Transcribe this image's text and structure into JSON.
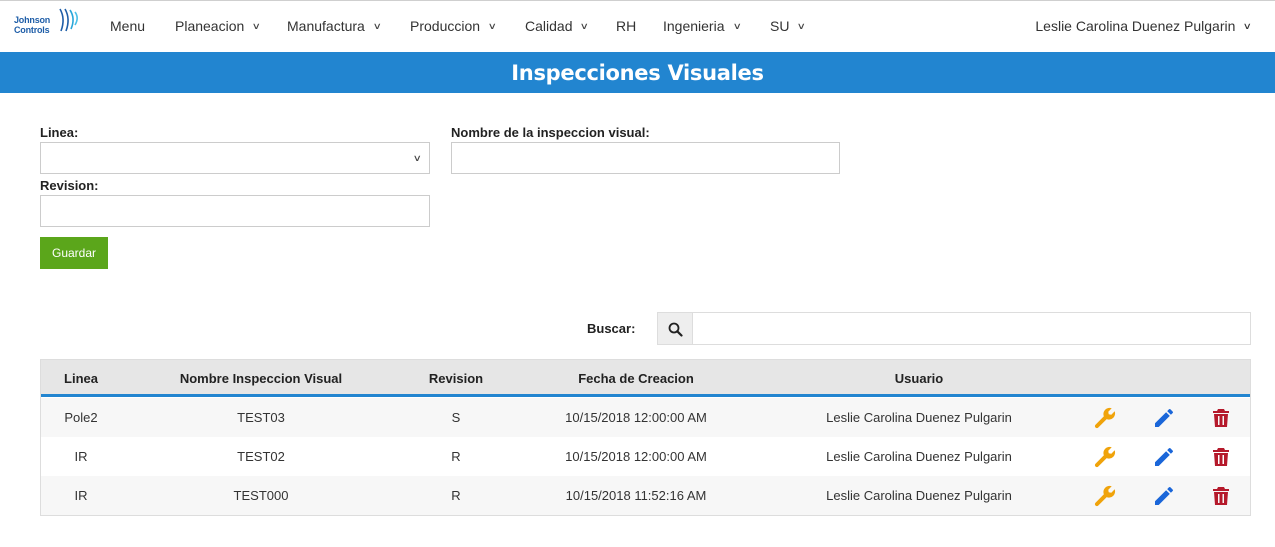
{
  "brand": {
    "line1": "Johnson",
    "line2": "Controls"
  },
  "nav": {
    "items": [
      {
        "label": "Menu",
        "dropdown": false
      },
      {
        "label": "Planeacion",
        "dropdown": true
      },
      {
        "label": "Manufactura",
        "dropdown": true
      },
      {
        "label": "Produccion",
        "dropdown": true
      },
      {
        "label": "Calidad",
        "dropdown": true
      },
      {
        "label": "RH",
        "dropdown": false
      },
      {
        "label": "Ingenieria",
        "dropdown": true
      },
      {
        "label": "SU",
        "dropdown": true
      }
    ],
    "user": "Leslie Carolina Duenez Pulgarin"
  },
  "page": {
    "title": "Inspecciones Visuales"
  },
  "form": {
    "linea_label": "Linea:",
    "linea_value": "",
    "nombre_label": "Nombre de la inspeccion visual:",
    "nombre_value": "",
    "revision_label": "Revision:",
    "revision_value": "",
    "save_label": "Guardar"
  },
  "search": {
    "label": "Buscar:",
    "value": ""
  },
  "table": {
    "headers": [
      "Linea",
      "Nombre Inspeccion Visual",
      "Revision",
      "Fecha de Creacion",
      "Usuario"
    ],
    "rows": [
      {
        "linea": "Pole2",
        "nombre": "TEST03",
        "revision": "S",
        "fecha": "10/15/2018 12:00:00 AM",
        "usuario": "Leslie Carolina Duenez Pulgarin"
      },
      {
        "linea": "IR",
        "nombre": "TEST02",
        "revision": "R",
        "fecha": "10/15/2018 12:00:00 AM",
        "usuario": "Leslie Carolina Duenez Pulgarin"
      },
      {
        "linea": "IR",
        "nombre": "TEST000",
        "revision": "R",
        "fecha": "10/15/2018 11:52:16 AM",
        "usuario": "Leslie Carolina Duenez Pulgarin"
      }
    ]
  },
  "icons": {
    "configure": "wrench-icon",
    "edit": "pencil-icon",
    "delete": "trash-icon",
    "search": "search-icon"
  },
  "colors": {
    "primary": "#2285d0",
    "success": "#5ba61b",
    "wrench": "#f0a30a",
    "pencil": "#1a66d9",
    "trash": "#b5192b"
  }
}
